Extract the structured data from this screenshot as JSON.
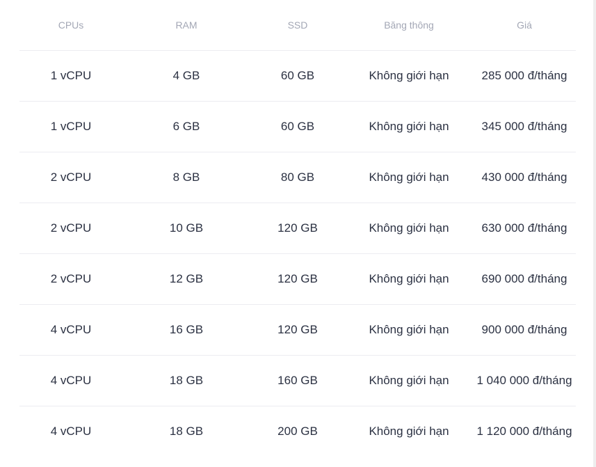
{
  "table": {
    "headers": [
      "CPUs",
      "RAM",
      "SSD",
      "Băng thông",
      "Giá"
    ],
    "rows": [
      [
        "1 vCPU",
        "4 GB",
        "60 GB",
        "Không giới hạn",
        "285 000 đ/tháng"
      ],
      [
        "1 vCPU",
        "6 GB",
        "60 GB",
        "Không giới hạn",
        "345 000 đ/tháng"
      ],
      [
        "2 vCPU",
        "8 GB",
        "80 GB",
        "Không giới hạn",
        "430 000 đ/tháng"
      ],
      [
        "2 vCPU",
        "10 GB",
        "120 GB",
        "Không giới hạn",
        "630 000 đ/tháng"
      ],
      [
        "2 vCPU",
        "12 GB",
        "120 GB",
        "Không giới hạn",
        "690 000 đ/tháng"
      ],
      [
        "4 vCPU",
        "16 GB",
        "120 GB",
        "Không giới hạn",
        "900 000 đ/tháng"
      ],
      [
        "4 vCPU",
        "18 GB",
        "160 GB",
        "Không giới hạn",
        "1 040 000 đ/tháng"
      ],
      [
        "4 vCPU",
        "18 GB",
        "200 GB",
        "Không giới hạn",
        "1 120 000 đ/tháng"
      ]
    ]
  },
  "colors": {
    "header_text": "#a3a7b5",
    "cell_text": "#2b3142",
    "divider": "#ececf1",
    "background": "#ffffff"
  }
}
